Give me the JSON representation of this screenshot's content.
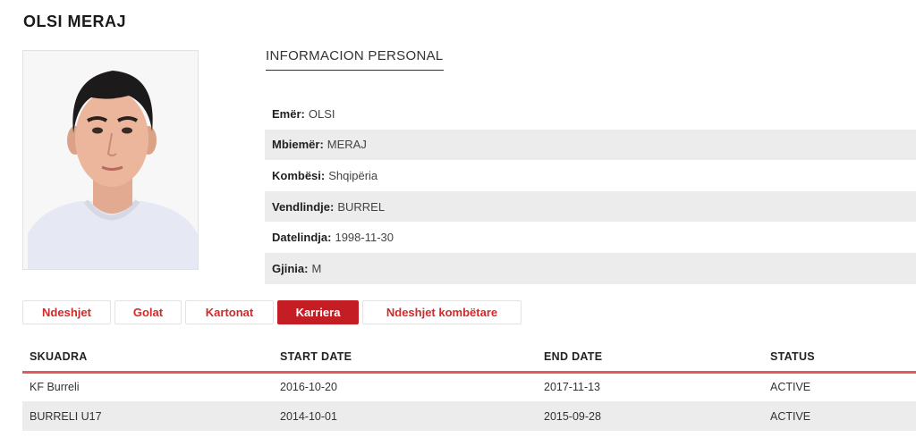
{
  "player": {
    "name": "OLSI MERAJ"
  },
  "info": {
    "heading": "INFORMACION PERSONAL",
    "rows": [
      {
        "label": "Emër:",
        "value": "OLSI"
      },
      {
        "label": "Mbiemër:",
        "value": "MERAJ"
      },
      {
        "label": "Kombësi:",
        "value": "Shqipëria"
      },
      {
        "label": "Vendlindje:",
        "value": "BURREL"
      },
      {
        "label": "Datelindja:",
        "value": "1998-11-30"
      },
      {
        "label": "Gjinia:",
        "value": "M"
      }
    ]
  },
  "tabs": [
    {
      "label": "Ndeshjet",
      "active": false
    },
    {
      "label": "Golat",
      "active": false
    },
    {
      "label": "Kartonat",
      "active": false
    },
    {
      "label": "Karriera",
      "active": true
    },
    {
      "label": "Ndeshjet kombëtare",
      "active": false
    }
  ],
  "career": {
    "headers": [
      "SKUADRA",
      "START DATE",
      "END DATE",
      "STATUS"
    ],
    "rows": [
      [
        "KF Burreli",
        "2016-10-20",
        "2017-11-13",
        "ACTIVE"
      ],
      [
        "BURRELI U17",
        "2014-10-01",
        "2015-09-28",
        "ACTIVE"
      ]
    ]
  },
  "colors": {
    "accent": "#c41e24",
    "header_rule": "#e45a5a",
    "row_alt": "#ececec"
  }
}
